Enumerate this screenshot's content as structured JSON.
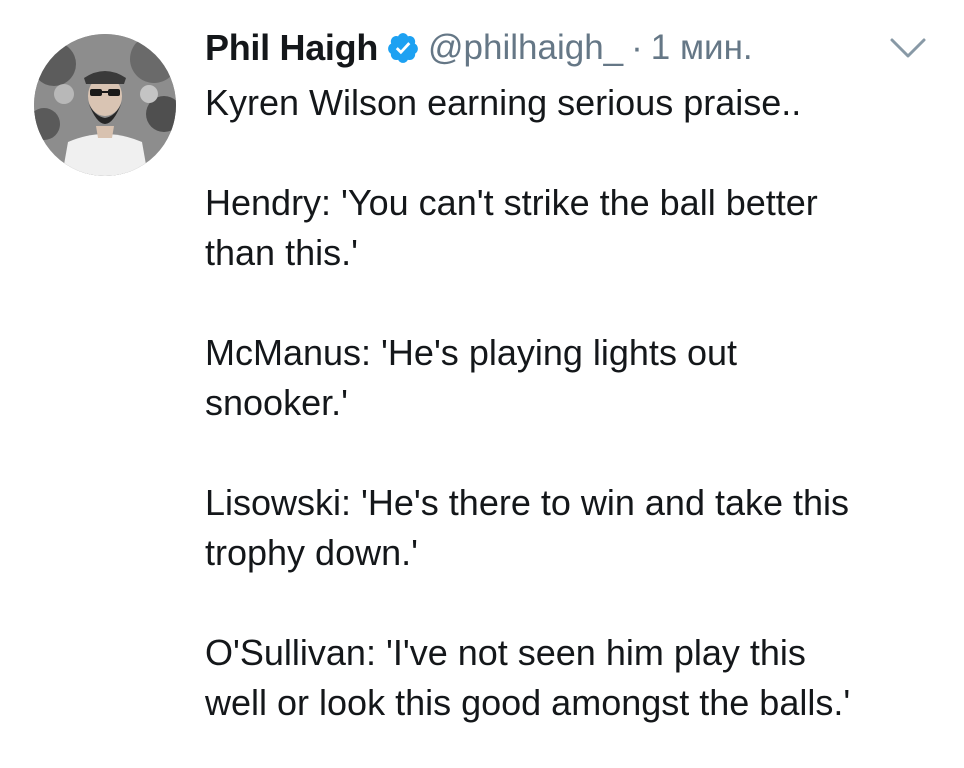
{
  "tweet": {
    "display_name": "Phil Haigh",
    "handle": "@philhaigh_",
    "separator": "·",
    "timestamp": "1 мин.",
    "verified_icon": "verified-badge-icon",
    "menu_icon": "chevron-down-icon",
    "avatar_icon": "profile-photo",
    "colors": {
      "verified": "#1da1f2",
      "secondary_text": "#657786",
      "primary_text": "#14171a"
    },
    "paragraphs": [
      {
        "lines": [
          "Kyren Wilson earning serious praise.."
        ]
      },
      {
        "lines": [
          "Hendry: 'You can't strike the ball better",
          "than this.'"
        ]
      },
      {
        "lines": [
          "McManus: 'He's playing lights out",
          "snooker.'"
        ]
      },
      {
        "lines": [
          "Lisowski: 'He's there to win and take this",
          "trophy down.'"
        ]
      },
      {
        "lines": [
          "O'Sullivan: 'I've not seen him play this",
          "well or look this good amongst the balls.'"
        ]
      }
    ]
  }
}
